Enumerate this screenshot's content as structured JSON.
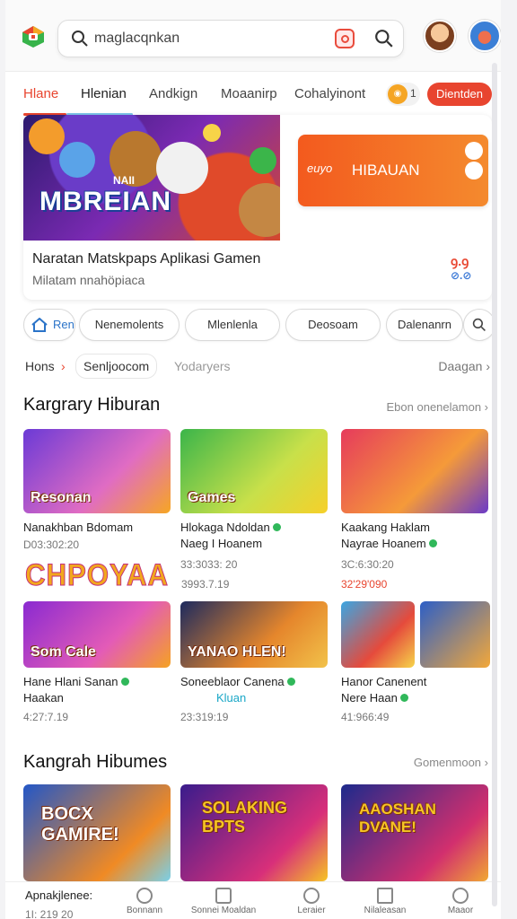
{
  "search": {
    "query": "maglacqnkan"
  },
  "tabs": [
    {
      "label": "Hlane"
    },
    {
      "label": "Hlenian"
    },
    {
      "label": "Andkign"
    },
    {
      "label": "Moaanirp"
    },
    {
      "label": "Cohalyinont"
    }
  ],
  "header": {
    "coin_count": "1",
    "cta_label": "Dientden"
  },
  "hero": {
    "game_title": "MBREIAN",
    "game_subtitle": "NAII",
    "promo_mini": "euyo",
    "promo_text": "HIBAUAN",
    "title": "Naratan Matskpaps Aplikasi Gamen",
    "subtitle": "Milatam nnahöpiaca",
    "badge_top": "ꝯ.ꝯ",
    "badge_bottom": "⊘.⊘"
  },
  "chips": [
    {
      "label": "Ren"
    },
    {
      "label": "Nenemolents"
    },
    {
      "label": "Mlenlenla"
    },
    {
      "label": "Deosoam"
    },
    {
      "label": "Dalenanrn"
    }
  ],
  "breadcrumb": {
    "home": "Hons",
    "current": "Senljoocom",
    "next": "Yodaryers",
    "right": "Daagan"
  },
  "section1": {
    "title": "Kargrary Hiburan",
    "link": "Ebon onenelamon",
    "cards": [
      {
        "thumb_label": "Resonan",
        "title": "Nanakhban Bdomam",
        "sub": "",
        "meta": "D03:302:20",
        "price": "",
        "colors": [
          "#6b3ad6",
          "#e06cc3",
          "#f6a623"
        ]
      },
      {
        "thumb_label": "Games",
        "title": "Hlokaga Ndoldan",
        "sub": "Naeg I Hoanem",
        "meta": "33:3033: 20",
        "price": "",
        "colors": [
          "#3bb54a",
          "#c8e04a",
          "#f6d02a"
        ]
      },
      {
        "thumb_label": "",
        "title": "Kaakang Haklam",
        "sub": "Nayrae Hoanem",
        "meta": "3C:6:30:20",
        "price": "32'29'090",
        "colors": [
          "#e63b5c",
          "#f59a39",
          "#6a3ac8"
        ]
      }
    ],
    "promo_logo": "CHPOYAA",
    "promo_meta": "3993.7.19"
  },
  "section2": {
    "cards": [
      {
        "thumb_label": "Som Cale",
        "title": "Hane Hlani Sanan",
        "sub": "Haakan",
        "meta": "4:27:7.19",
        "colors": [
          "#8a2ad1",
          "#e35bb7",
          "#f5a223"
        ]
      },
      {
        "thumb_label": "YANAO HLEN!",
        "title": "Soneeblaor Canena",
        "sub": "Kluan",
        "meta": "23:319:19",
        "colors": [
          "#1d2a5e",
          "#e5862c",
          "#f2c24a"
        ]
      },
      {
        "thumb_label": "",
        "title": "Hanor Canenent",
        "sub": "Nere Haan",
        "meta": "41:966:49",
        "colors": [
          "#3aa6e3",
          "#e54a3c",
          "#f6d54a"
        ]
      }
    ]
  },
  "section3": {
    "title": "Kangrah Hibumes",
    "link": "Gomenmoon",
    "cards": [
      {
        "thumb_label": "BOCX GAMIRE!",
        "colors": [
          "#2357c7",
          "#f08a24",
          "#7ad0e8"
        ]
      },
      {
        "thumb_label": "SOLAKING BPTS",
        "colors": [
          "#3a1c8c",
          "#d82f7a",
          "#f6c524"
        ]
      },
      {
        "thumb_label": "AAOSHAN DVANE!",
        "colors": [
          "#1d2a8c",
          "#d22f6e",
          "#f1a833"
        ]
      }
    ]
  },
  "bottom": {
    "label": "Apnakjlenee:",
    "meta": "1I: 219 20",
    "nav": [
      {
        "label": "Bonnann"
      },
      {
        "label": "Sonnei Moaldan"
      },
      {
        "label": "Leraier"
      },
      {
        "label": "Nilaleasan"
      },
      {
        "label": "Maaor"
      }
    ]
  }
}
